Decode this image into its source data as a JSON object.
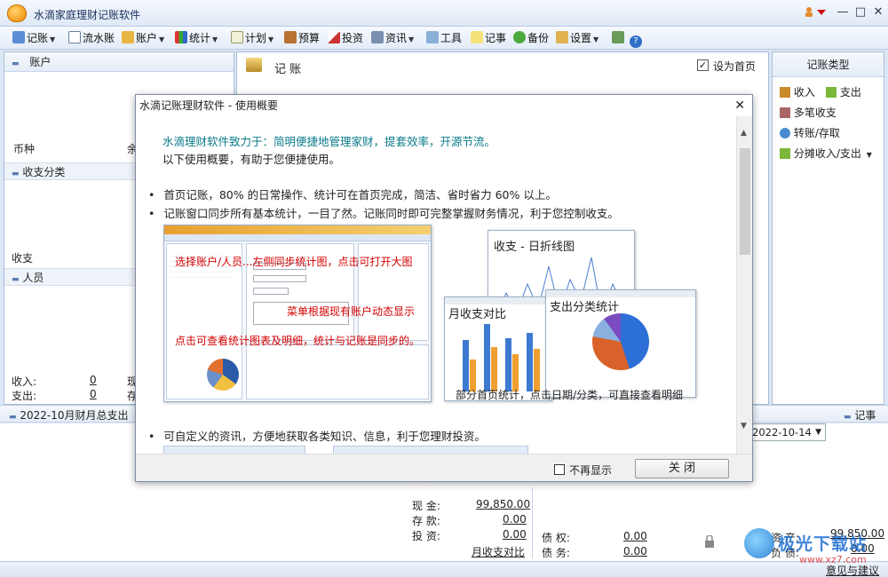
{
  "window": {
    "title": "水滴家庭理财记账软件",
    "minimize": "—",
    "maximize": "□",
    "close": "✕"
  },
  "toolbar": {
    "items": [
      "记账",
      "流水账",
      "账户",
      "统计",
      "计划",
      "预算",
      "投资",
      "资讯",
      "工具",
      "记事",
      "备份",
      "设置"
    ]
  },
  "left_panel": {
    "header": "账户",
    "currency_label": "币种",
    "balance_label_partial": "余",
    "income_expense_section": "收支分类",
    "expense_label": "收支",
    "people_section": "人员",
    "income_label": "收入:",
    "expense_label2": "支出:",
    "income_value": "0",
    "expense_value": "0",
    "cut1": "现",
    "cut2": "存"
  },
  "center_panel": {
    "header": "记 账",
    "set_home_label": "设为首页",
    "set_home_checked": true
  },
  "right_panel": {
    "header": "记账类型",
    "items": [
      "收入",
      "支出",
      "多笔收支",
      "转账/存取",
      "分摊收入/支出"
    ]
  },
  "bottom_left": {
    "header": "2022-10月财月总支出",
    "rows": [
      {
        "label": "现 金:",
        "value": "99,850.00"
      },
      {
        "label": "存 款:",
        "value": "0.00"
      },
      {
        "label": "投 资:",
        "value": "0.00"
      }
    ],
    "partial_label": "投 资:",
    "link": "月收支对比"
  },
  "bottom_right": {
    "notes_header": "记事",
    "date_value": "2022-10-14",
    "rows": [
      {
        "label": "债 权:",
        "value": "0.00"
      },
      {
        "label": "债 务:",
        "value": "0.00"
      }
    ],
    "assets_label": "资 产:",
    "assets_value": "99,850.00",
    "liab_label": "负 债:",
    "liab_value": "0.00",
    "feedback": "意见与建议"
  },
  "watermark": {
    "text1": "极光下载站",
    "text2": "www.xz7.com"
  },
  "dialog": {
    "title": "水滴记账理财软件 - 使用概要",
    "close": "✕",
    "intro_line1": "水滴理财软件致力于：简明便捷地管理家财，提套效率，开源节流。",
    "intro_line2": "以下使用概要，有助于您便捷使用。",
    "bullets": [
      "首页记账，80% 的日常操作、统计可在首页完成，简洁、省时省力 60% 以上。",
      "记账窗口同步所有基本统计，一目了然。记账同时即可完整掌握财务情况，利于您控制收支。",
      "可自定义的资讯，方便地获取各类知识、信息，利于您理财投资。"
    ],
    "annotations": [
      "选择账户/人员...左侧同步统计图，点击可打开大图",
      "菜单根据现有账户动态显示",
      "点击可查看统计图表及明细，统计与记账是同步的。"
    ],
    "chart_titles": [
      "收支 - 日折线图",
      "月收支对比",
      "支出分类统计"
    ],
    "caption": "部分首页统计，点击日期/分类，可直接查看明细",
    "no_show_label": "不再显示",
    "close_button": "关 闭"
  }
}
